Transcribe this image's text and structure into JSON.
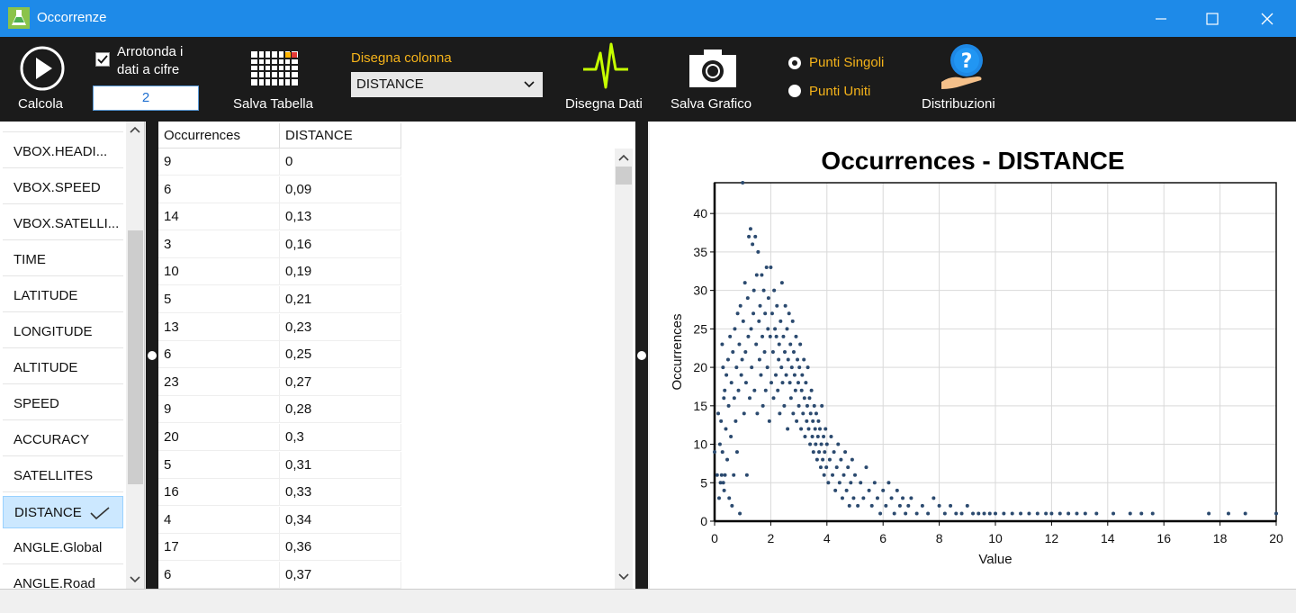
{
  "window": {
    "title": "Occorrenze",
    "minimize_icon": "minimize-icon",
    "maximize_icon": "maximize-icon",
    "close_icon": "close-icon"
  },
  "toolbar": {
    "calcola_label": "Calcola",
    "round_label_line1": "Arrotonda i",
    "round_label_line2": "dati a cifre",
    "round_checked": true,
    "round_digits": "2",
    "salva_tabella_label": "Salva Tabella",
    "disegna_colonna_label": "Disegna colonna",
    "selected_column": "DISTANCE",
    "disegna_dati_label": "Disegna Dati",
    "salva_grafico_label": "Salva Grafico",
    "punti_singoli_label": "Punti Singoli",
    "punti_uniti_label": "Punti Uniti",
    "distribuzioni_label": "Distribuzioni",
    "accent_color": "#f5b31a"
  },
  "columns_list": {
    "items": [
      "VBOX.HEADI...",
      "VBOX.SPEED",
      "VBOX.SATELLI...",
      "TIME",
      "LATITUDE",
      "LONGITUDE",
      "ALTITUDE",
      "SPEED",
      "ACCURACY",
      "SATELLITES",
      "DISTANCE",
      "ANGLE.Global",
      "ANGLE.Road"
    ],
    "selected": "DISTANCE"
  },
  "table": {
    "headers": [
      "Occurrences",
      "DISTANCE"
    ],
    "rows": [
      [
        "9",
        "0"
      ],
      [
        "6",
        "0,09"
      ],
      [
        "14",
        "0,13"
      ],
      [
        "3",
        "0,16"
      ],
      [
        "10",
        "0,19"
      ],
      [
        "5",
        "0,21"
      ],
      [
        "13",
        "0,23"
      ],
      [
        "6",
        "0,25"
      ],
      [
        "23",
        "0,27"
      ],
      [
        "9",
        "0,28"
      ],
      [
        "20",
        "0,3"
      ],
      [
        "5",
        "0,31"
      ],
      [
        "16",
        "0,33"
      ],
      [
        "4",
        "0,34"
      ],
      [
        "17",
        "0,36"
      ],
      [
        "6",
        "0,37"
      ]
    ]
  },
  "chart_data": {
    "type": "scatter",
    "title": "Occurrences  - DISTANCE",
    "xlabel": "Value",
    "ylabel": "Occurrences",
    "xlim": [
      0,
      20
    ],
    "ylim": [
      0,
      44
    ],
    "xticks": [
      "0",
      "2",
      "4",
      "6",
      "8",
      "10",
      "12",
      "14",
      "16",
      "18",
      "20"
    ],
    "yticks": [
      "0",
      "5",
      "10",
      "15",
      "20",
      "25",
      "30",
      "35",
      "40"
    ],
    "grid": true,
    "marker_color": "#2b4a6f",
    "points": [
      [
        0,
        9
      ],
      [
        0.09,
        6
      ],
      [
        0.13,
        14
      ],
      [
        0.16,
        3
      ],
      [
        0.19,
        10
      ],
      [
        0.21,
        5
      ],
      [
        0.23,
        13
      ],
      [
        0.25,
        6
      ],
      [
        0.27,
        23
      ],
      [
        0.28,
        9
      ],
      [
        0.3,
        20
      ],
      [
        0.31,
        5
      ],
      [
        0.33,
        16
      ],
      [
        0.34,
        4
      ],
      [
        0.36,
        17
      ],
      [
        0.37,
        6
      ],
      [
        0.4,
        12
      ],
      [
        0.42,
        19
      ],
      [
        0.45,
        8
      ],
      [
        0.48,
        21
      ],
      [
        0.5,
        15
      ],
      [
        0.52,
        3
      ],
      [
        0.55,
        24
      ],
      [
        0.58,
        11
      ],
      [
        0.6,
        18
      ],
      [
        0.62,
        2
      ],
      [
        0.65,
        22
      ],
      [
        0.68,
        6
      ],
      [
        0.7,
        16
      ],
      [
        0.72,
        25
      ],
      [
        0.75,
        13
      ],
      [
        0.78,
        20
      ],
      [
        0.8,
        9
      ],
      [
        0.82,
        27
      ],
      [
        0.85,
        17
      ],
      [
        0.88,
        23
      ],
      [
        0.9,
        1
      ],
      [
        0.92,
        28
      ],
      [
        0.95,
        19
      ],
      [
        0.98,
        21
      ],
      [
        1.0,
        44
      ],
      [
        1.02,
        26
      ],
      [
        1.05,
        14
      ],
      [
        1.08,
        31
      ],
      [
        1.1,
        22
      ],
      [
        1.12,
        18
      ],
      [
        1.15,
        6
      ],
      [
        1.18,
        29
      ],
      [
        1.2,
        24
      ],
      [
        1.22,
        37
      ],
      [
        1.25,
        16
      ],
      [
        1.28,
        38
      ],
      [
        1.3,
        25
      ],
      [
        1.32,
        20
      ],
      [
        1.35,
        36
      ],
      [
        1.38,
        27
      ],
      [
        1.4,
        30
      ],
      [
        1.42,
        17
      ],
      [
        1.45,
        37
      ],
      [
        1.48,
        23
      ],
      [
        1.5,
        32
      ],
      [
        1.52,
        14
      ],
      [
        1.55,
        35
      ],
      [
        1.58,
        26
      ],
      [
        1.6,
        21
      ],
      [
        1.62,
        28
      ],
      [
        1.65,
        19
      ],
      [
        1.68,
        32
      ],
      [
        1.7,
        24
      ],
      [
        1.72,
        15
      ],
      [
        1.75,
        30
      ],
      [
        1.78,
        22
      ],
      [
        1.8,
        27
      ],
      [
        1.82,
        17
      ],
      [
        1.85,
        33
      ],
      [
        1.88,
        20
      ],
      [
        1.9,
        25
      ],
      [
        1.92,
        29
      ],
      [
        1.95,
        13
      ],
      [
        1.98,
        24
      ],
      [
        2.0,
        33
      ],
      [
        2.02,
        18
      ],
      [
        2.05,
        27
      ],
      [
        2.08,
        22
      ],
      [
        2.1,
        16
      ],
      [
        2.12,
        30
      ],
      [
        2.15,
        25
      ],
      [
        2.18,
        19
      ],
      [
        2.2,
        24
      ],
      [
        2.22,
        28
      ],
      [
        2.25,
        17
      ],
      [
        2.28,
        21
      ],
      [
        2.3,
        23
      ],
      [
        2.32,
        14
      ],
      [
        2.35,
        26
      ],
      [
        2.38,
        20
      ],
      [
        2.4,
        31
      ],
      [
        2.42,
        18
      ],
      [
        2.45,
        24
      ],
      [
        2.48,
        15
      ],
      [
        2.5,
        22
      ],
      [
        2.52,
        28
      ],
      [
        2.55,
        19
      ],
      [
        2.58,
        25
      ],
      [
        2.6,
        12
      ],
      [
        2.62,
        21
      ],
      [
        2.65,
        27
      ],
      [
        2.68,
        18
      ],
      [
        2.7,
        23
      ],
      [
        2.72,
        16
      ],
      [
        2.75,
        20
      ],
      [
        2.78,
        26
      ],
      [
        2.8,
        14
      ],
      [
        2.82,
        22
      ],
      [
        2.85,
        19
      ],
      [
        2.88,
        17
      ],
      [
        2.9,
        24
      ],
      [
        2.92,
        13
      ],
      [
        2.95,
        21
      ],
      [
        2.98,
        18
      ],
      [
        3.0,
        15
      ],
      [
        3.02,
        20
      ],
      [
        3.05,
        23
      ],
      [
        3.08,
        12
      ],
      [
        3.1,
        17
      ],
      [
        3.12,
        19
      ],
      [
        3.15,
        14
      ],
      [
        3.18,
        21
      ],
      [
        3.2,
        16
      ],
      [
        3.22,
        11
      ],
      [
        3.25,
        18
      ],
      [
        3.28,
        13
      ],
      [
        3.3,
        15
      ],
      [
        3.32,
        20
      ],
      [
        3.35,
        12
      ],
      [
        3.38,
        16
      ],
      [
        3.4,
        10
      ],
      [
        3.42,
        14
      ],
      [
        3.45,
        17
      ],
      [
        3.48,
        11
      ],
      [
        3.5,
        13
      ],
      [
        3.52,
        9
      ],
      [
        3.55,
        15
      ],
      [
        3.58,
        12
      ],
      [
        3.6,
        10
      ],
      [
        3.62,
        14
      ],
      [
        3.65,
        8
      ],
      [
        3.68,
        11
      ],
      [
        3.7,
        13
      ],
      [
        3.72,
        9
      ],
      [
        3.75,
        12
      ],
      [
        3.78,
        7
      ],
      [
        3.8,
        10
      ],
      [
        3.82,
        15
      ],
      [
        3.85,
        8
      ],
      [
        3.88,
        11
      ],
      [
        3.9,
        6
      ],
      [
        3.92,
        9
      ],
      [
        3.95,
        12
      ],
      [
        3.98,
        7
      ],
      [
        4.0,
        10
      ],
      [
        4.05,
        5
      ],
      [
        4.1,
        8
      ],
      [
        4.15,
        11
      ],
      [
        4.2,
        6
      ],
      [
        4.25,
        9
      ],
      [
        4.3,
        4
      ],
      [
        4.35,
        7
      ],
      [
        4.4,
        10
      ],
      [
        4.45,
        5
      ],
      [
        4.5,
        8
      ],
      [
        4.55,
        3
      ],
      [
        4.6,
        6
      ],
      [
        4.65,
        9
      ],
      [
        4.7,
        4
      ],
      [
        4.75,
        7
      ],
      [
        4.8,
        2
      ],
      [
        4.85,
        5
      ],
      [
        4.9,
        8
      ],
      [
        4.95,
        3
      ],
      [
        5.0,
        6
      ],
      [
        5.1,
        2
      ],
      [
        5.2,
        5
      ],
      [
        5.3,
        3
      ],
      [
        5.4,
        7
      ],
      [
        5.5,
        4
      ],
      [
        5.6,
        2
      ],
      [
        5.7,
        5
      ],
      [
        5.8,
        3
      ],
      [
        5.9,
        1
      ],
      [
        6.0,
        4
      ],
      [
        6.1,
        2
      ],
      [
        6.2,
        5
      ],
      [
        6.3,
        3
      ],
      [
        6.4,
        1
      ],
      [
        6.5,
        4
      ],
      [
        6.6,
        2
      ],
      [
        6.7,
        3
      ],
      [
        6.8,
        1
      ],
      [
        6.9,
        2
      ],
      [
        7.0,
        3
      ],
      [
        7.2,
        1
      ],
      [
        7.4,
        2
      ],
      [
        7.6,
        1
      ],
      [
        7.8,
        3
      ],
      [
        8.0,
        2
      ],
      [
        8.2,
        1
      ],
      [
        8.4,
        2
      ],
      [
        8.6,
        1
      ],
      [
        8.8,
        1
      ],
      [
        9.0,
        2
      ],
      [
        9.2,
        1
      ],
      [
        9.4,
        1
      ],
      [
        9.6,
        1
      ],
      [
        9.8,
        1
      ],
      [
        10.0,
        1
      ],
      [
        10.3,
        1
      ],
      [
        10.6,
        1
      ],
      [
        10.9,
        1
      ],
      [
        11.2,
        1
      ],
      [
        11.5,
        1
      ],
      [
        11.8,
        1
      ],
      [
        12.0,
        1
      ],
      [
        12.3,
        1
      ],
      [
        12.6,
        1
      ],
      [
        12.9,
        1
      ],
      [
        13.2,
        1
      ],
      [
        13.6,
        1
      ],
      [
        14.2,
        1
      ],
      [
        14.8,
        1
      ],
      [
        15.2,
        1
      ],
      [
        15.6,
        1
      ],
      [
        17.6,
        1
      ],
      [
        18.3,
        1
      ],
      [
        18.9,
        1
      ],
      [
        20,
        1
      ]
    ]
  }
}
